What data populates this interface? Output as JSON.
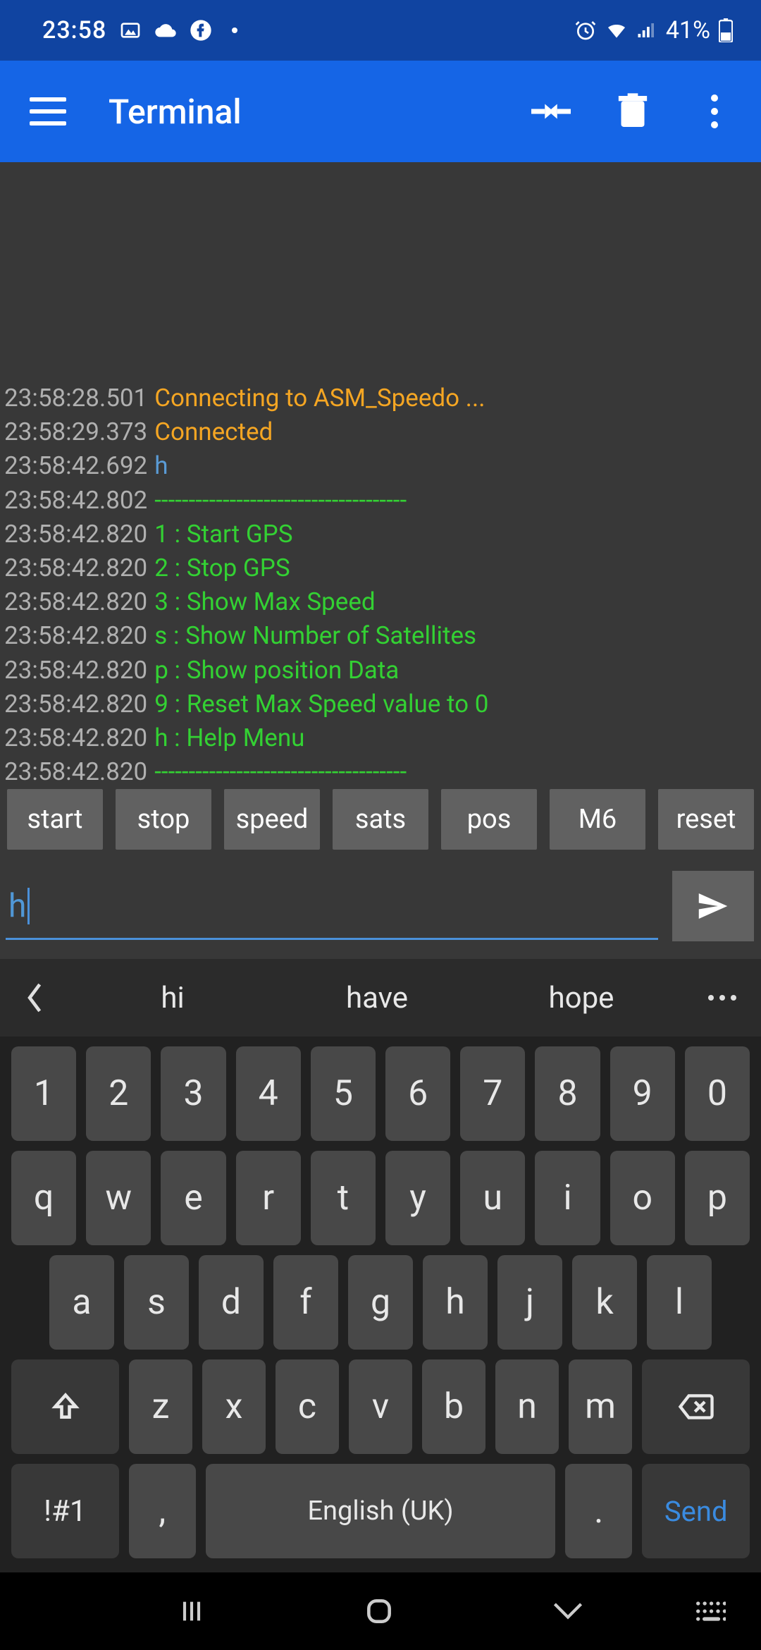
{
  "status": {
    "time": "23:58",
    "battery": "41%"
  },
  "header": {
    "title": "Terminal"
  },
  "terminal": {
    "lines": [
      {
        "ts": "23:58:28.501",
        "text": "Connecting to ASM_Speedo ...",
        "cls": "orange"
      },
      {
        "ts": "23:58:29.373",
        "text": "Connected",
        "cls": "orange"
      },
      {
        "ts": "23:58:42.692",
        "text": "h",
        "cls": "blue"
      },
      {
        "ts": "23:58:42.802",
        "text": "-------------------------------------",
        "cls": "green"
      },
      {
        "ts": "23:58:42.820",
        "text": "1 : Start GPS",
        "cls": "green"
      },
      {
        "ts": "23:58:42.820",
        "text": "2 : Stop GPS",
        "cls": "green"
      },
      {
        "ts": "23:58:42.820",
        "text": "3 : Show Max Speed",
        "cls": "green"
      },
      {
        "ts": "23:58:42.820",
        "text": "s : Show Number of Satellites",
        "cls": "green"
      },
      {
        "ts": "23:58:42.820",
        "text": "p : Show position Data",
        "cls": "green"
      },
      {
        "ts": "23:58:42.820",
        "text": "9 : Reset Max Speed value to 0",
        "cls": "green"
      },
      {
        "ts": "23:58:42.820",
        "text": "h : Help Menu",
        "cls": "green"
      },
      {
        "ts": "23:58:42.820",
        "text": "-------------------------------------",
        "cls": "green"
      }
    ]
  },
  "macros": [
    "start",
    "stop",
    "speed",
    "sats",
    "pos",
    "M6",
    "reset"
  ],
  "input": {
    "value": "h"
  },
  "suggestions": [
    "hi",
    "have",
    "hope"
  ],
  "keyboard": {
    "row1": [
      "1",
      "2",
      "3",
      "4",
      "5",
      "6",
      "7",
      "8",
      "9",
      "0"
    ],
    "row2": [
      "q",
      "w",
      "e",
      "r",
      "t",
      "y",
      "u",
      "i",
      "o",
      "p"
    ],
    "row3": [
      "a",
      "s",
      "d",
      "f",
      "g",
      "h",
      "j",
      "k",
      "l"
    ],
    "row4": [
      "z",
      "x",
      "c",
      "v",
      "b",
      "n",
      "m"
    ],
    "sym": "!#1",
    "comma": ",",
    "space": "English (UK)",
    "period": ".",
    "send": "Send"
  }
}
